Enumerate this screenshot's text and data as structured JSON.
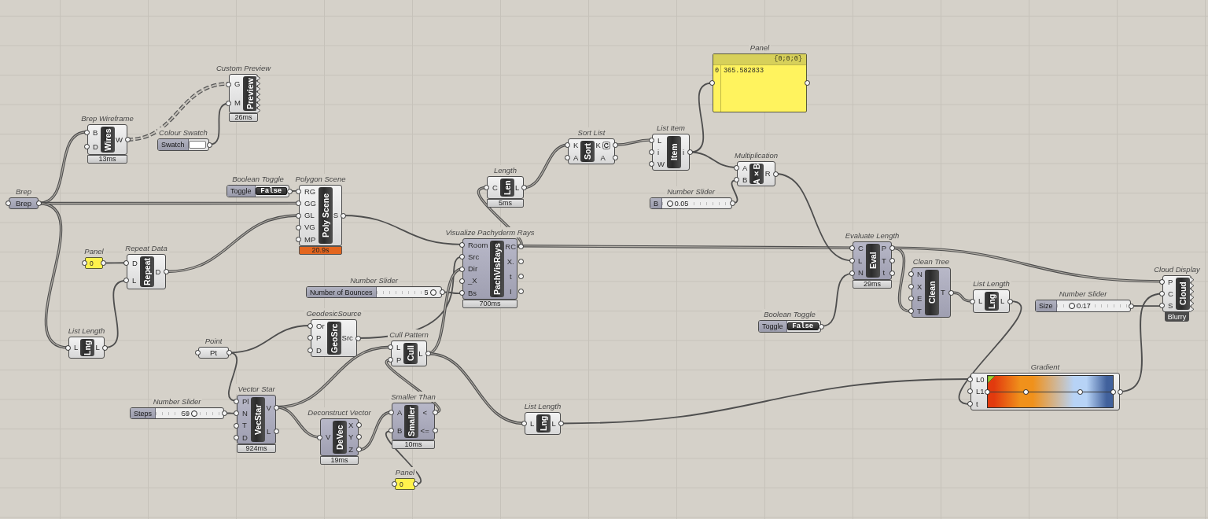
{
  "canvas": {
    "nodes": [
      {
        "kind": "panel",
        "title": "Panel",
        "header": "{0;0;0}",
        "rows": [
          {
            "index": "0",
            "value": "365.582833"
          }
        ]
      },
      {
        "kind": "component",
        "title": "Custom Preview",
        "nickname": "Preview",
        "preview_off": false,
        "inputs": [
          "G",
          "M"
        ],
        "footer": {
          "kind": "timing",
          "text": "26ms"
        }
      },
      {
        "kind": "component",
        "title": "Brep Wireframe",
        "nickname": "Wires",
        "preview_off": false,
        "inputs": [
          "B",
          "D"
        ],
        "outputs": [
          "W"
        ],
        "footer": {
          "kind": "timing",
          "text": "13ms"
        }
      },
      {
        "kind": "swatch",
        "title": "Colour Swatch",
        "label": "Swatch",
        "color": "#ffffff"
      },
      {
        "kind": "component",
        "title": "Sort List",
        "nickname": "Sort",
        "preview_off": false,
        "inputs": [
          "K",
          "A"
        ],
        "outputs": [
          {
            "label": "K",
            "reversed": true
          },
          {
            "label": "A",
            "reversed": false
          }
        ]
      },
      {
        "kind": "component",
        "title": "List Item",
        "nickname": "Item",
        "preview_off": false,
        "inputs": [
          "L",
          "i",
          "W"
        ],
        "outputs": [
          "i"
        ]
      },
      {
        "kind": "component",
        "title": "Multiplication",
        "nickname": "A×B",
        "preview_off": false,
        "inputs": [
          "A",
          "B"
        ],
        "outputs": [
          "R"
        ]
      },
      {
        "kind": "component",
        "title": "Length",
        "nickname": "Len",
        "preview_off": false,
        "inputs": [
          "C"
        ],
        "outputs": [
          "L"
        ],
        "footer": {
          "kind": "timing",
          "text": "5ms"
        }
      },
      {
        "kind": "toggle",
        "title": "Boolean Toggle",
        "label": "Toggle",
        "value": "False"
      },
      {
        "kind": "component",
        "title": "Polygon Scene",
        "nickname": "Poly Scene",
        "preview_off": false,
        "inputs": [
          "RG",
          "GG",
          "GL",
          "VG",
          "MP"
        ],
        "outputs": [
          "S"
        ],
        "footer": {
          "kind": "warning",
          "text": "20.9s"
        }
      },
      {
        "kind": "parameter",
        "title": "Brep",
        "label": "Brep",
        "preview_off": true
      },
      {
        "kind": "slider",
        "title": "Number Slider",
        "label": "B",
        "value": "0.05",
        "level": 0.05
      },
      {
        "kind": "component",
        "title": "Visualize Pachyderm Rays",
        "nickname": "PachVisRays",
        "preview_off": true,
        "inputs": [
          "Room",
          "Src",
          "Dir",
          "_X",
          "Bs"
        ],
        "outputs": [
          "RC",
          "X.",
          "t",
          "I"
        ],
        "footer": {
          "kind": "timing",
          "text": "700ms"
        }
      },
      {
        "kind": "component",
        "title": "Evaluate Length",
        "nickname": "Eval",
        "preview_off": true,
        "inputs": [
          "C",
          "L",
          "N"
        ],
        "outputs": [
          "P",
          "T",
          "t"
        ],
        "footer": {
          "kind": "timing",
          "text": "29ms"
        }
      },
      {
        "kind": "panel",
        "title": "Panel",
        "rows": [
          {
            "value": "0"
          }
        ]
      },
      {
        "kind": "component",
        "title": "Repeat Data",
        "nickname": "Repeat",
        "preview_off": false,
        "inputs": [
          "D",
          "L"
        ],
        "outputs": [
          "D"
        ]
      },
      {
        "kind": "component",
        "title": "Clean Tree",
        "nickname": "Clean",
        "preview_off": true,
        "inputs": [
          "N",
          "X",
          "E",
          "T"
        ],
        "outputs": [
          "T"
        ]
      },
      {
        "kind": "component",
        "title": "Cloud Display",
        "nickname": "Cloud",
        "preview_off": false,
        "inputs": [
          "P",
          "C",
          "S"
        ],
        "footer": {
          "kind": "message",
          "text": "Blurry"
        }
      },
      {
        "kind": "slider",
        "title": "Number Slider",
        "label": "Number of Bounces",
        "value": "5",
        "level": 0.95
      },
      {
        "kind": "component",
        "title": "List Length",
        "nickname": "Lng",
        "preview_off": false,
        "inputs": [
          "L"
        ],
        "outputs": [
          "L"
        ]
      },
      {
        "kind": "slider",
        "title": "Number Slider",
        "label": "Size",
        "value": "0.17",
        "level": 0.17
      },
      {
        "kind": "component",
        "title": "GeodesicSource",
        "nickname": "GeoSrc",
        "preview_off": false,
        "inputs": [
          "Or",
          "P",
          "D"
        ],
        "outputs": [
          "Src"
        ]
      },
      {
        "kind": "toggle",
        "title": "Boolean Toggle",
        "label": "Toggle",
        "value": "False"
      },
      {
        "kind": "component",
        "title": "List Length",
        "nickname": "Lng",
        "preview_off": false,
        "inputs": [
          "L"
        ],
        "outputs": [
          "L"
        ]
      },
      {
        "kind": "component",
        "title": "Cull Pattern",
        "nickname": "Cull",
        "preview_off": false,
        "inputs": [
          "L",
          "P"
        ],
        "outputs": [
          "L"
        ]
      },
      {
        "kind": "parameter",
        "title": "Point",
        "label": "Pt",
        "preview_off": false
      },
      {
        "kind": "gradient",
        "title": "Gradient",
        "inputs": [
          "L0",
          "L1",
          "t"
        ],
        "stops": [
          {
            "level": 0,
            "color": "#e23a0e"
          },
          {
            "level": 0.31,
            "color": "#f0911b"
          },
          {
            "level": 0.74,
            "color": "#b7d3f6"
          },
          {
            "level": 1,
            "color": "#41619c"
          }
        ]
      },
      {
        "kind": "component",
        "title": "Vector Star",
        "nickname": "VecStar",
        "preview_off": true,
        "inputs": [
          "Pl",
          "N",
          "T",
          "D"
        ],
        "outputs": [
          "V",
          "L"
        ],
        "footer": {
          "kind": "timing",
          "text": "924ms"
        }
      },
      {
        "kind": "component",
        "title": "Smaller Than",
        "nickname": "Smaller",
        "preview_off": true,
        "inputs": [
          "A",
          "B"
        ],
        "outputs": [
          "<",
          "<="
        ],
        "footer": {
          "kind": "timing",
          "text": "10ms"
        }
      },
      {
        "kind": "slider",
        "title": "Number Slider",
        "label": "Steps",
        "value": "59",
        "level": 0.59
      },
      {
        "kind": "component",
        "title": "List Length",
        "nickname": "Lng",
        "preview_off": false,
        "inputs": [
          "L"
        ],
        "outputs": [
          "L"
        ]
      },
      {
        "kind": "component",
        "title": "Deconstruct Vector",
        "nickname": "DeVec",
        "preview_off": true,
        "inputs": [
          "V"
        ],
        "outputs": [
          "X",
          "Y",
          "Z"
        ],
        "footer": {
          "kind": "timing",
          "text": "19ms"
        }
      },
      {
        "kind": "panel",
        "title": "Panel",
        "rows": [
          {
            "value": "0"
          }
        ]
      }
    ]
  }
}
